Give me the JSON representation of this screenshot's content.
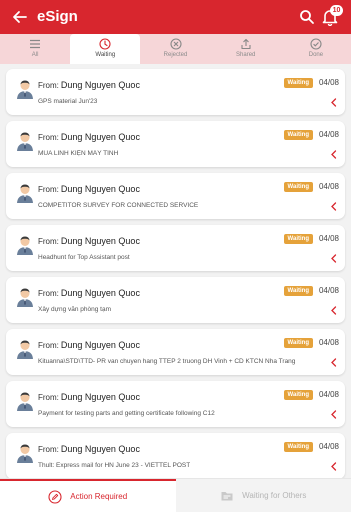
{
  "header": {
    "title": "eSign",
    "badge_count": "10",
    "accent_color": "#d8262e",
    "icons": [
      "back-arrow-icon",
      "search-icon",
      "bell-icon"
    ]
  },
  "tabs": [
    {
      "label": "All",
      "icon": "list-icon",
      "active": false
    },
    {
      "label": "Waiting",
      "icon": "clock-icon",
      "active": true
    },
    {
      "label": "Rejected",
      "icon": "x-circle-icon",
      "active": false
    },
    {
      "label": "Shared",
      "icon": "share-icon",
      "active": false
    },
    {
      "label": "Done",
      "icon": "check-circle-icon",
      "active": false
    }
  ],
  "items": [
    {
      "from_label": "From:",
      "sender": "Dung Nguyen Quoc",
      "subject": "GPS material Jun'23",
      "status": "Waiting",
      "date": "04/08"
    },
    {
      "from_label": "From:",
      "sender": "Dung Nguyen Quoc",
      "subject": "MUA LINH KIỆN MÁY TÍNH",
      "status": "Waiting",
      "date": "04/08"
    },
    {
      "from_label": "From:",
      "sender": "Dung Nguyen Quoc",
      "subject": "COMPETITOR SURVEY FOR CONNECTED SERVICE",
      "status": "Waiting",
      "date": "04/08"
    },
    {
      "from_label": "From:",
      "sender": "Dung Nguyen Quoc",
      "subject": "Headhunt for Top Assistant post",
      "status": "Waiting",
      "date": "04/08"
    },
    {
      "from_label": "From:",
      "sender": "Dung Nguyen Quoc",
      "subject": "Xây dựng văn phòng tạm",
      "status": "Waiting",
      "date": "04/08"
    },
    {
      "from_label": "From:",
      "sender": "Dung Nguyen Quoc",
      "subject": "Kituanna\\STD\\TTD- PR van chuyen hang TTEP 2 truong DH Vinh + CD KTCN Nha Trang",
      "status": "Waiting",
      "date": "04/08"
    },
    {
      "from_label": "From:",
      "sender": "Dung Nguyen Quoc",
      "subject": "Payment for testing parts and getting certificate following C12",
      "status": "Waiting",
      "date": "04/08"
    },
    {
      "from_label": "From:",
      "sender": "Dung Nguyen Quoc",
      "subject": "Thult: Express mail for HN June 23 - VIETTEL POST",
      "status": "Waiting",
      "date": "04/08"
    }
  ],
  "bottom_nav": [
    {
      "label": "Action Required",
      "icon": "edit-icon",
      "active": true
    },
    {
      "label": "Waiting for Others",
      "icon": "folder-icon",
      "active": false
    }
  ],
  "status_color": "#e5a23a"
}
